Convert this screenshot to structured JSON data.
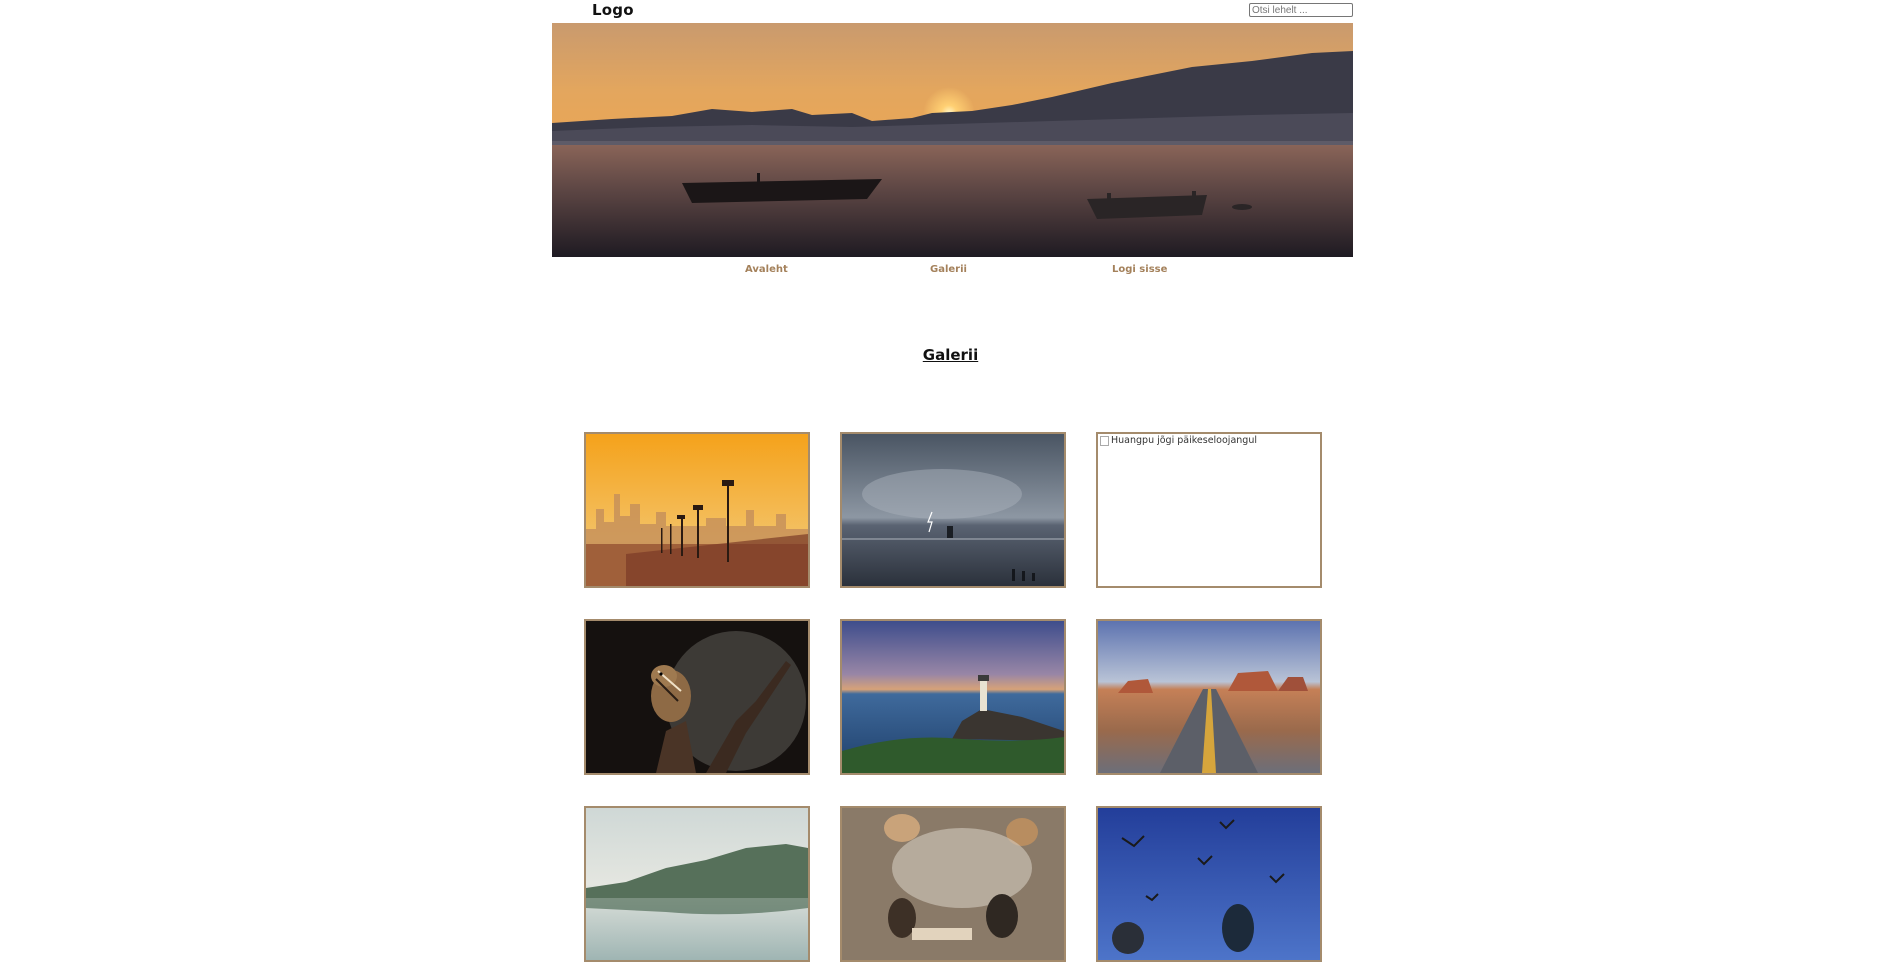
{
  "header": {
    "logo": "Logo",
    "search_placeholder": "Otsi lehelt ..."
  },
  "nav": {
    "items": [
      {
        "label": "Avaleht"
      },
      {
        "label": "Galerii"
      },
      {
        "label": "Logi sisse"
      }
    ]
  },
  "main": {
    "title": "Galerii"
  },
  "gallery": {
    "broken_image_alt": "Huangpu jõgi päikeseloojangul"
  },
  "colors": {
    "nav_link": "#a4815b",
    "thumb_border": "#a48b6c"
  }
}
